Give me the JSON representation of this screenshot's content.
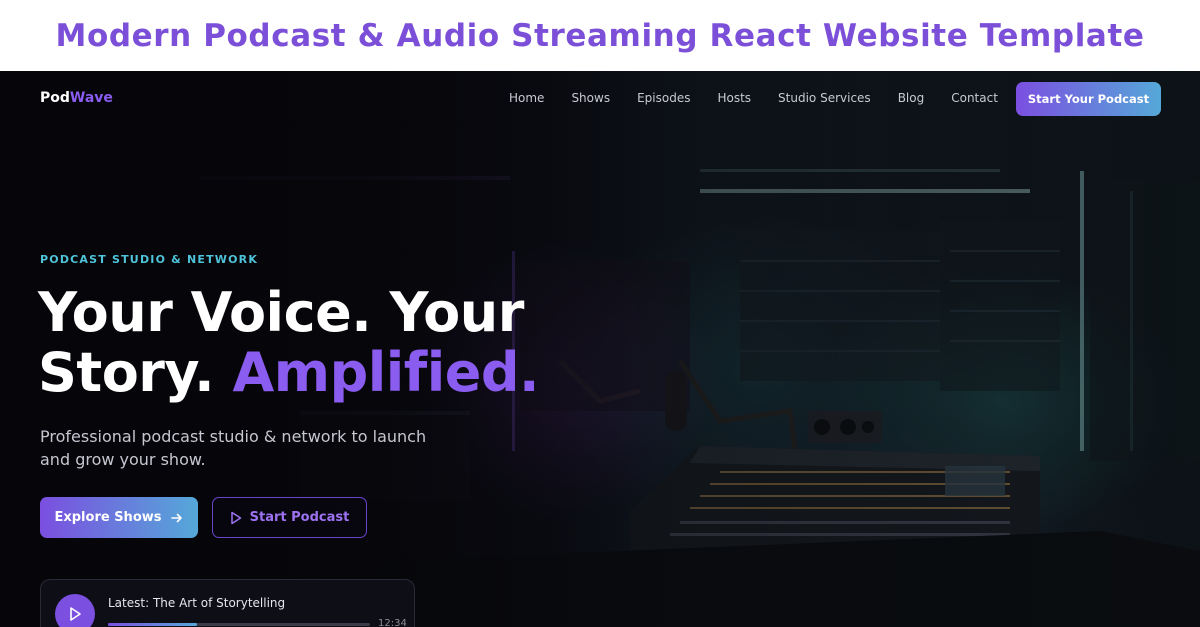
{
  "banner": {
    "title": "Modern Podcast & Audio Streaming React Website Template"
  },
  "nav": {
    "logo_main": "Pod",
    "logo_accent": "Wave",
    "links": [
      "Home",
      "Shows",
      "Episodes",
      "Hosts",
      "Studio Services",
      "Blog",
      "Contact"
    ],
    "cta_label": "Start Your Podcast"
  },
  "hero": {
    "eyebrow": "PODCAST STUDIO & NETWORK",
    "headline_part1": "Your Voice. Your Story.",
    "headline_highlight": "Amplified.",
    "subtitle": "Professional podcast studio & network to launch and grow your show.",
    "primary_button": "Explore Shows",
    "secondary_button": "Start Podcast"
  },
  "player": {
    "title": "Latest: The Art of Storytelling",
    "time": "12:34",
    "progress_fraction": 0.34
  },
  "colors": {
    "accent_purple": "#8a5cf0",
    "accent_teal": "#4fc3d9",
    "gradient_start": "#7b4fe0",
    "gradient_end": "#55a8d8"
  },
  "icons": {
    "primary_button_icon": "arrow-right-icon",
    "secondary_button_icon": "play-outline-icon",
    "player_icon": "play-icon"
  }
}
